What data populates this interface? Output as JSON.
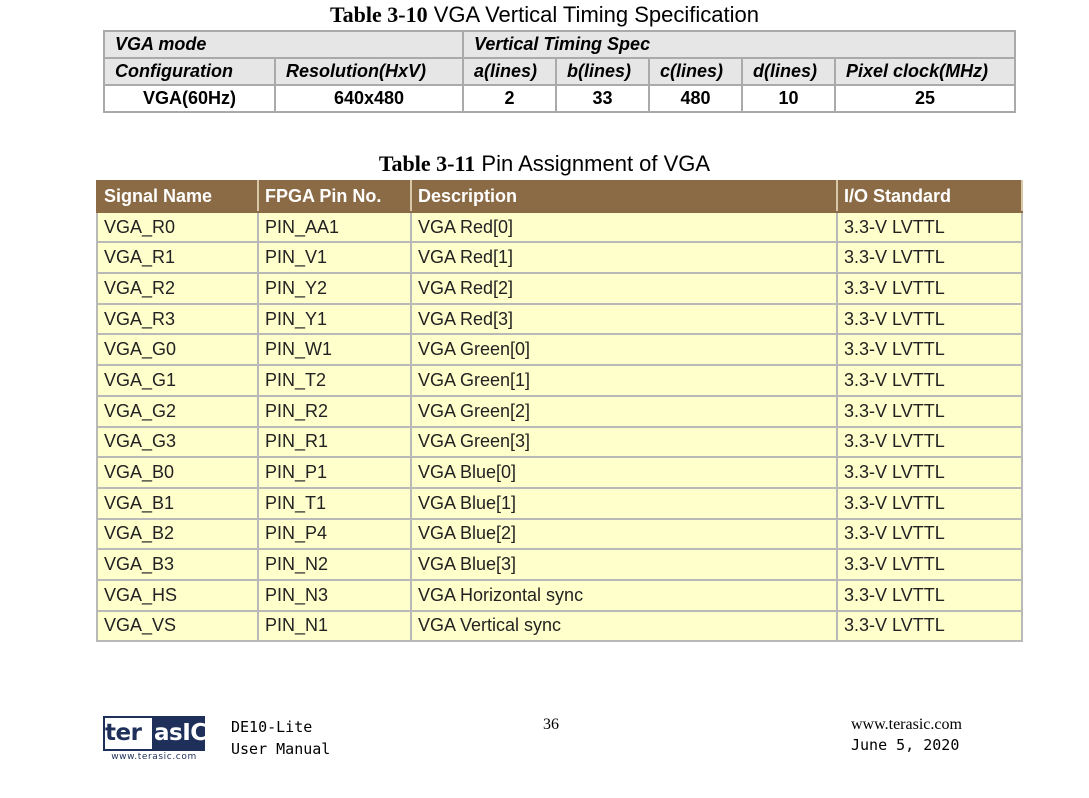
{
  "table1": {
    "caption_num": "Table 3-10",
    "caption_text": "VGA Vertical Timing Specification",
    "row1": [
      "VGA mode",
      "Vertical Timing Spec"
    ],
    "headers": [
      "Configuration",
      "Resolution(HxV)",
      "a(lines)",
      "b(lines)",
      "c(lines)",
      "d(lines)",
      "Pixel clock(MHz)"
    ],
    "data": [
      "VGA(60Hz)",
      "640x480",
      "2",
      "33",
      "480",
      "10",
      "25"
    ]
  },
  "table2": {
    "caption_num": "Table 3-11",
    "caption_text": "Pin Assignment of VGA",
    "headers": [
      "Signal Name",
      "FPGA Pin No.",
      "Description",
      "I/O Standard"
    ],
    "rows": [
      [
        "VGA_R0",
        "PIN_AA1",
        "VGA Red[0]",
        "3.3-V LVTTL"
      ],
      [
        "VGA_R1",
        "PIN_V1",
        "VGA Red[1]",
        "3.3-V LVTTL"
      ],
      [
        "VGA_R2",
        "PIN_Y2",
        "VGA Red[2]",
        "3.3-V LVTTL"
      ],
      [
        "VGA_R3",
        "PIN_Y1",
        "VGA Red[3]",
        "3.3-V LVTTL"
      ],
      [
        "VGA_G0",
        "PIN_W1",
        "VGA Green[0]",
        "3.3-V LVTTL"
      ],
      [
        "VGA_G1",
        "PIN_T2",
        "VGA Green[1]",
        "3.3-V LVTTL"
      ],
      [
        "VGA_G2",
        "PIN_R2",
        "VGA Green[2]",
        "3.3-V LVTTL"
      ],
      [
        "VGA_G3",
        "PIN_R1",
        "VGA Green[3]",
        "3.3-V LVTTL"
      ],
      [
        "VGA_B0",
        "PIN_P1",
        "VGA Blue[0]",
        "3.3-V LVTTL"
      ],
      [
        "VGA_B1",
        "PIN_T1",
        "VGA Blue[1]",
        "3.3-V LVTTL"
      ],
      [
        "VGA_B2",
        "PIN_P4",
        "VGA Blue[2]",
        "3.3-V LVTTL"
      ],
      [
        "VGA_B3",
        "PIN_N2",
        "VGA Blue[3]",
        "3.3-V LVTTL"
      ],
      [
        "VGA_HS",
        "PIN_N3",
        "VGA Horizontal sync",
        "3.3-V LVTTL"
      ],
      [
        "VGA_VS",
        "PIN_N1",
        "VGA Vertical sync",
        "3.3-V LVTTL"
      ]
    ]
  },
  "footer": {
    "logo_left": "ter",
    "logo_right": "asIC",
    "logo_url": "www.terasic.com",
    "product": "DE10-Lite",
    "doc": "User Manual",
    "page": "36",
    "website": "www.terasic.com",
    "date": "June 5, 2020"
  },
  "colors": {
    "header_brown": "#8b6b45",
    "cell_yellow": "#ffffcc",
    "header_gray": "#e6e6e6",
    "logo_navy": "#1e2f5a"
  }
}
